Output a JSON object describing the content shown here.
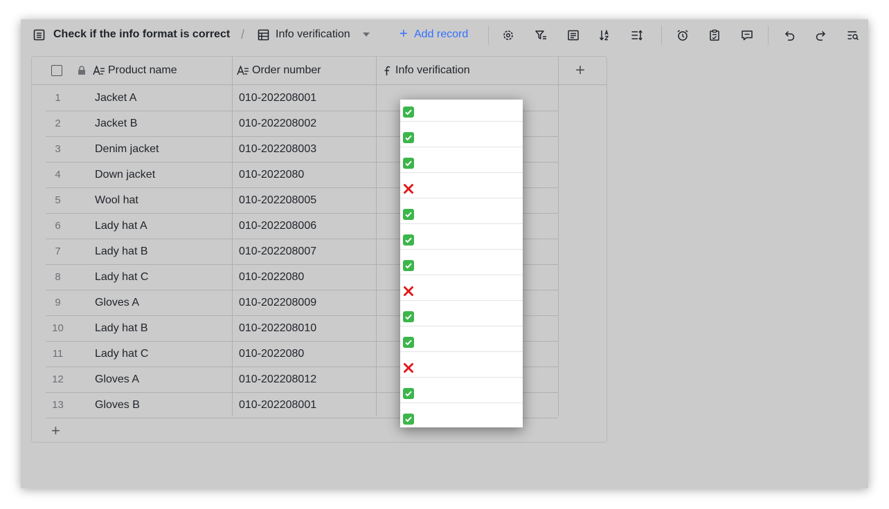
{
  "toolbar": {
    "doc_title": "Check if the info format is correct",
    "separator": "/",
    "view_name": "Info verification",
    "add_record_plus": "+",
    "add_record_label": "Add record"
  },
  "table": {
    "columns": [
      "Product name",
      "Order number",
      "Info verification"
    ],
    "add_column_symbol": "+",
    "add_row_symbol": "+",
    "rows": [
      {
        "n": "1",
        "product": "Jacket A",
        "order": "010-202208001",
        "ok": true
      },
      {
        "n": "2",
        "product": "Jacket B",
        "order": "010-202208002",
        "ok": true
      },
      {
        "n": "3",
        "product": "Denim jacket",
        "order": "010-202208003",
        "ok": true
      },
      {
        "n": "4",
        "product": "Down jacket",
        "order": "010-2022080",
        "ok": false
      },
      {
        "n": "5",
        "product": "Wool hat",
        "order": "010-202208005",
        "ok": true
      },
      {
        "n": "6",
        "product": "Lady hat A",
        "order": "010-202208006",
        "ok": true
      },
      {
        "n": "7",
        "product": "Lady hat B",
        "order": "010-202208007",
        "ok": true
      },
      {
        "n": "8",
        "product": "Lady hat C",
        "order": "010-2022080",
        "ok": false
      },
      {
        "n": "9",
        "product": "Gloves A",
        "order": "010-202208009",
        "ok": true
      },
      {
        "n": "10",
        "product": "Lady hat B",
        "order": "010-202208010",
        "ok": true
      },
      {
        "n": "11",
        "product": "Lady hat C",
        "order": "010-2022080",
        "ok": false
      },
      {
        "n": "12",
        "product": "Gloves A",
        "order": "010-202208012",
        "ok": true
      },
      {
        "n": "13",
        "product": "Gloves B",
        "order": "010-202208001",
        "ok": true
      }
    ]
  },
  "colors": {
    "accent": "#3370ff",
    "check_green": "#3cb64b",
    "cross_red": "#e0191b"
  },
  "icons": [
    "doc-icon",
    "grid-view-icon",
    "settings-icon",
    "filter-icon",
    "group-icon",
    "sort-icon",
    "row-height-icon",
    "alarm-icon",
    "form-icon",
    "comment-icon",
    "undo-icon",
    "redo-icon",
    "search-icon",
    "lock-icon",
    "text-field-icon",
    "formula-icon",
    "checkmark-icon",
    "cross-icon"
  ]
}
